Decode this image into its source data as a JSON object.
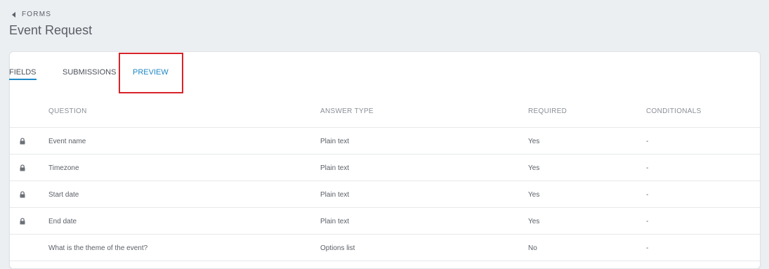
{
  "breadcrumb": {
    "label": "FORMS"
  },
  "page": {
    "title": "Event Request"
  },
  "tabs": [
    {
      "label": "FIELDS",
      "active": true
    },
    {
      "label": "SUBMISSIONS",
      "active": false
    },
    {
      "label": "PREVIEW",
      "active": false
    }
  ],
  "table": {
    "headers": {
      "question": "QUESTION",
      "answer_type": "ANSWER TYPE",
      "required": "REQUIRED",
      "conditionals": "CONDITIONALS"
    },
    "rows": [
      {
        "locked": true,
        "question": "Event name",
        "answer_type": "Plain text",
        "required": "Yes",
        "conditionals": "-"
      },
      {
        "locked": true,
        "question": "Timezone",
        "answer_type": "Plain text",
        "required": "Yes",
        "conditionals": "-"
      },
      {
        "locked": true,
        "question": "Start date",
        "answer_type": "Plain text",
        "required": "Yes",
        "conditionals": "-"
      },
      {
        "locked": true,
        "question": "End date",
        "answer_type": "Plain text",
        "required": "Yes",
        "conditionals": "-"
      },
      {
        "locked": false,
        "question": "What is the theme of the event?",
        "answer_type": "Options list",
        "required": "No",
        "conditionals": "-"
      }
    ]
  },
  "colors": {
    "accent": "#1f88c4",
    "highlight": "#d8232a",
    "background": "#eceff2"
  },
  "icons": {
    "back": "caret-left-icon",
    "lock": "lock-icon"
  }
}
